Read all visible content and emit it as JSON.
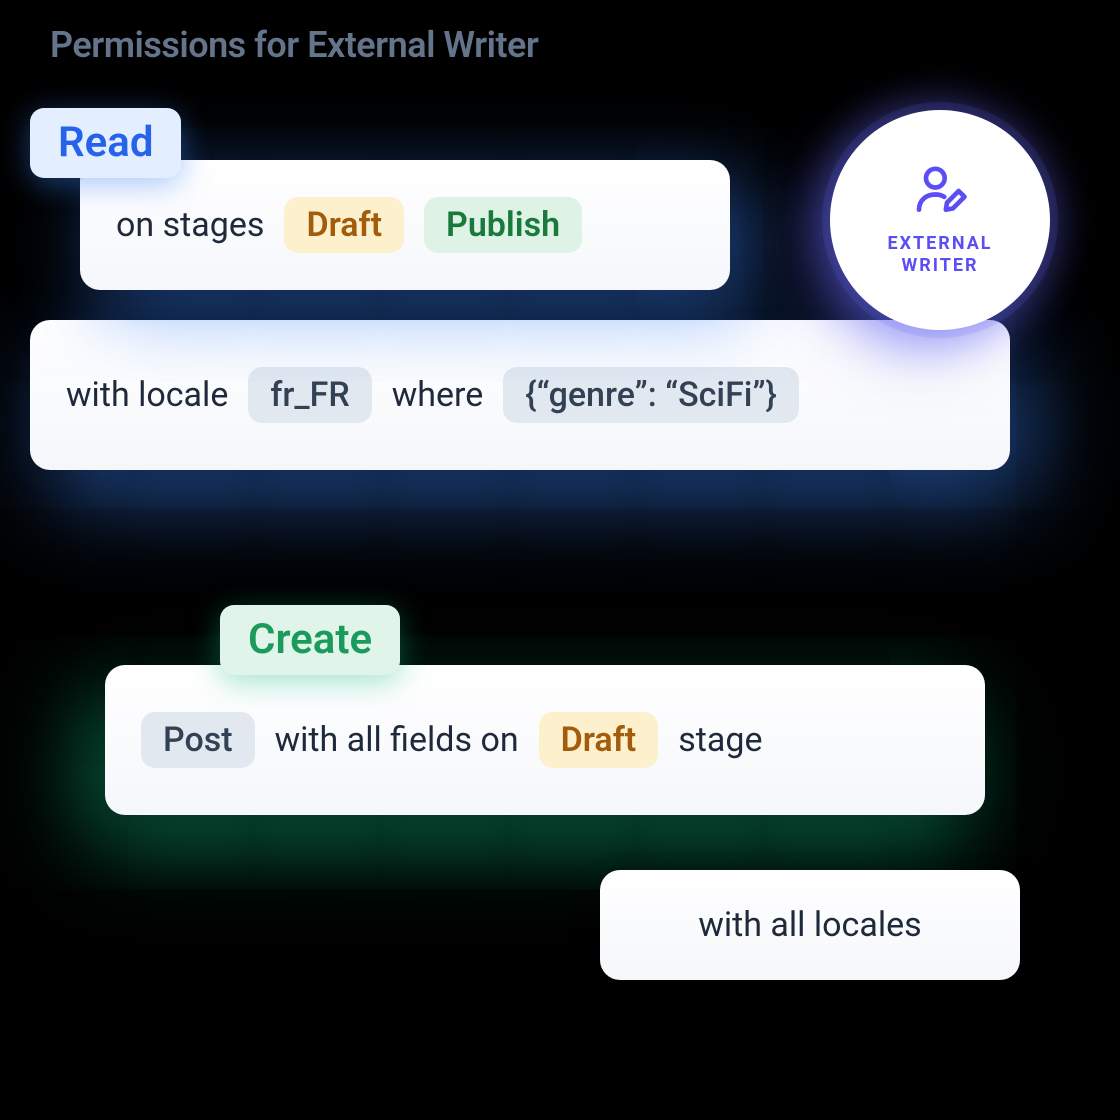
{
  "title": "Permissions for External Writer",
  "badge": {
    "line1": "EXTERNAL",
    "line2": "WRITER"
  },
  "read": {
    "chip": "Read",
    "stages_label": "on stages",
    "stage_draft": "Draft",
    "stage_publish": "Publish",
    "locale_label": "with locale",
    "locale_value": "fr_FR",
    "where_label": "where",
    "where_value": "{“genre”: “SciFi”}"
  },
  "create": {
    "chip": "Create",
    "model": "Post",
    "fields_label": "with all fields on",
    "stage_draft": "Draft",
    "stage_suffix": "stage",
    "locales": "with all locales"
  }
}
